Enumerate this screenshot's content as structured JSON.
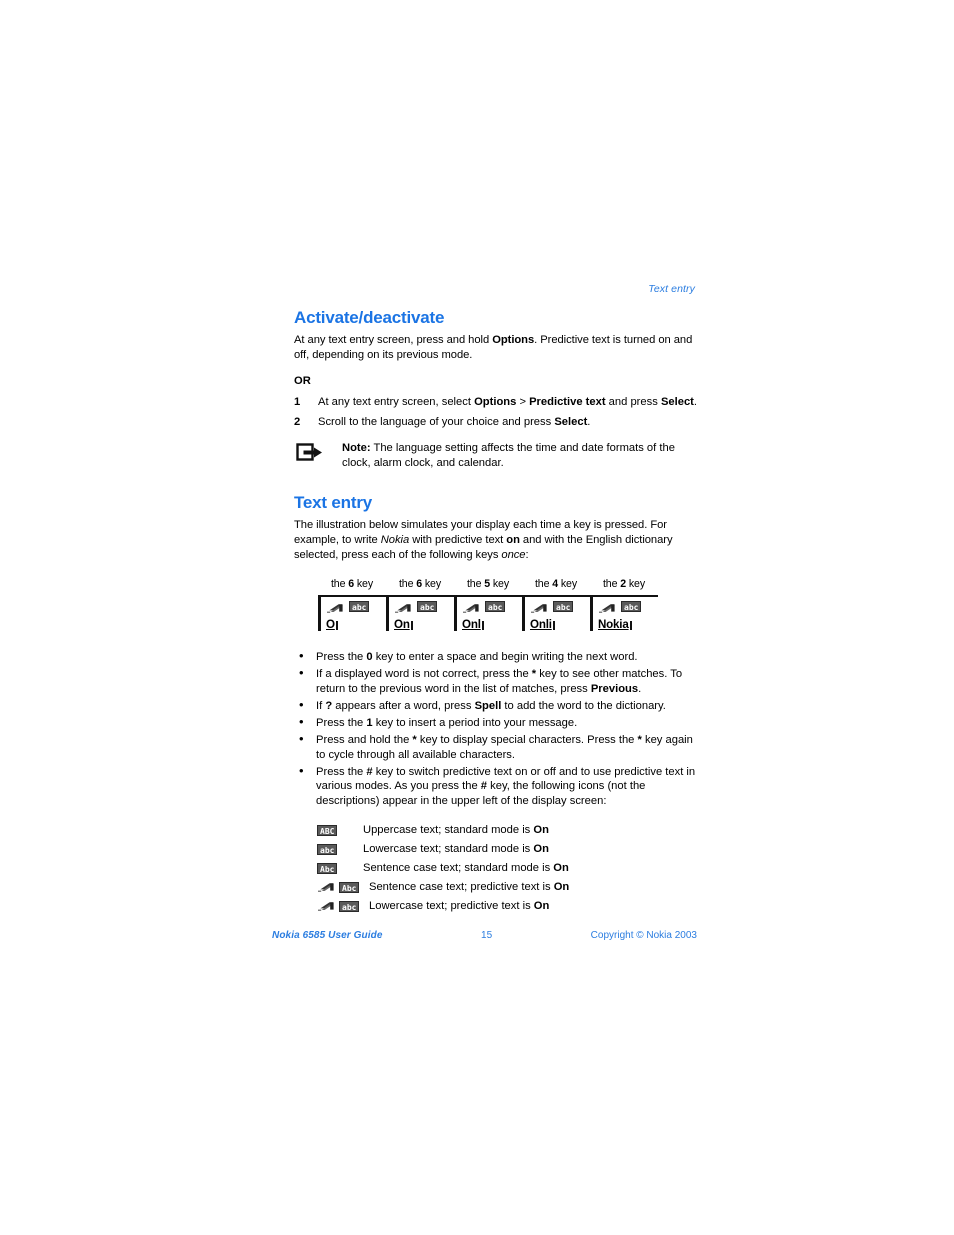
{
  "page": {
    "running_header": "Text entry",
    "background_color": "#ffffff",
    "accent_color": "#1b74e4",
    "footer_color": "#2b7de0"
  },
  "sections": {
    "activate": {
      "heading": "Activate/deactivate",
      "intro_parts": {
        "p1": "At any text entry screen, press and hold ",
        "b1": "Options",
        "p2": ". Predictive text is turned on and off, depending on its previous mode."
      },
      "or_label": "OR",
      "steps": [
        {
          "number": "1",
          "parts": {
            "t1": "At any text entry screen, select ",
            "b1": "Options",
            "t2": " > ",
            "b2": "Predictive text",
            "t3": " and press ",
            "b3": "Select",
            "t4": "."
          }
        },
        {
          "number": "2",
          "parts": {
            "t1": "Scroll to the language of your choice and press ",
            "b1": "Select",
            "t2": "."
          }
        }
      ],
      "note": {
        "icon": "note-arrow-icon",
        "label": "Note:",
        "text": " The language setting affects the time and date formats of the clock, alarm clock, and calendar."
      }
    },
    "text_entry": {
      "heading": "Text entry",
      "intro_parts": {
        "t1": "The illustration below simulates your display each time a key is pressed. For example, to write ",
        "i1": "Nokia",
        "t2": " with predictive text ",
        "b1": "on",
        "t3": " and with the English dictionary selected, press each of the following keys ",
        "i2": "once",
        "t4": ":"
      },
      "key_sequence": [
        {
          "caption_pre": "the ",
          "key": "6",
          "caption_post": " key",
          "badge": "abc",
          "word": "O",
          "swoosh": true
        },
        {
          "caption_pre": "the ",
          "key": "6",
          "caption_post": " key",
          "badge": "abc",
          "word": "On",
          "swoosh": true
        },
        {
          "caption_pre": "the ",
          "key": "5",
          "caption_post": " key",
          "badge": "abc",
          "word": "Onl",
          "swoosh": true
        },
        {
          "caption_pre": "the ",
          "key": "4",
          "caption_post": " key",
          "badge": "abc",
          "word": "Onli",
          "swoosh": true
        },
        {
          "caption_pre": "the ",
          "key": "2",
          "caption_post": " key",
          "badge": "abc",
          "word": "Nokia",
          "swoosh": true
        }
      ],
      "bullets": [
        {
          "parts": [
            {
              "type": "text",
              "v": "Press the "
            },
            {
              "type": "bold",
              "v": "0"
            },
            {
              "type": "text",
              "v": " key to enter a space and begin writing the next word."
            }
          ]
        },
        {
          "parts": [
            {
              "type": "text",
              "v": "If a displayed word is not correct, press the "
            },
            {
              "type": "bold",
              "v": "*"
            },
            {
              "type": "text",
              "v": " key to see other matches. To return to the previous word in the list of matches, press "
            },
            {
              "type": "bold",
              "v": "Previous"
            },
            {
              "type": "text",
              "v": "."
            }
          ]
        },
        {
          "parts": [
            {
              "type": "text",
              "v": "If "
            },
            {
              "type": "bold",
              "v": "?"
            },
            {
              "type": "text",
              "v": " appears after a word, press "
            },
            {
              "type": "bold",
              "v": "Spell"
            },
            {
              "type": "text",
              "v": " to add the word to the dictionary."
            }
          ]
        },
        {
          "parts": [
            {
              "type": "text",
              "v": "Press the "
            },
            {
              "type": "bold",
              "v": "1"
            },
            {
              "type": "text",
              "v": " key to insert a period into your message."
            }
          ]
        },
        {
          "parts": [
            {
              "type": "text",
              "v": "Press and hold the "
            },
            {
              "type": "bold",
              "v": "*"
            },
            {
              "type": "text",
              "v": " key to display special characters. Press the "
            },
            {
              "type": "bold",
              "v": "*"
            },
            {
              "type": "text",
              "v": " key again to cycle through all available characters."
            }
          ]
        },
        {
          "parts": [
            {
              "type": "text",
              "v": "Press the "
            },
            {
              "type": "bold",
              "v": "#"
            },
            {
              "type": "text",
              "v": " key to switch predictive text on or off and to use predictive text in various modes. As you press the "
            },
            {
              "type": "bold",
              "v": "#"
            },
            {
              "type": "text",
              "v": " key, the following icons (not the descriptions) appear in the upper left of the display screen:"
            }
          ]
        }
      ],
      "legend": [
        {
          "swoosh": false,
          "badge": "ABC",
          "text": "Uppercase text; standard mode is ",
          "state": "On"
        },
        {
          "swoosh": false,
          "badge": "abc",
          "text": "Lowercase text; standard mode is ",
          "state": "On"
        },
        {
          "swoosh": false,
          "badge": "Abc",
          "text": "Sentence case text; standard mode is ",
          "state": "On"
        },
        {
          "swoosh": true,
          "badge": "Abc",
          "text": "Sentence case text; predictive text is ",
          "state": "On"
        },
        {
          "swoosh": true,
          "badge": "abc",
          "text": "Lowercase text; predictive text is ",
          "state": "On"
        }
      ]
    }
  },
  "footer": {
    "left": "Nokia 6585 User Guide",
    "center": "15",
    "right": "Copyright © Nokia 2003"
  }
}
